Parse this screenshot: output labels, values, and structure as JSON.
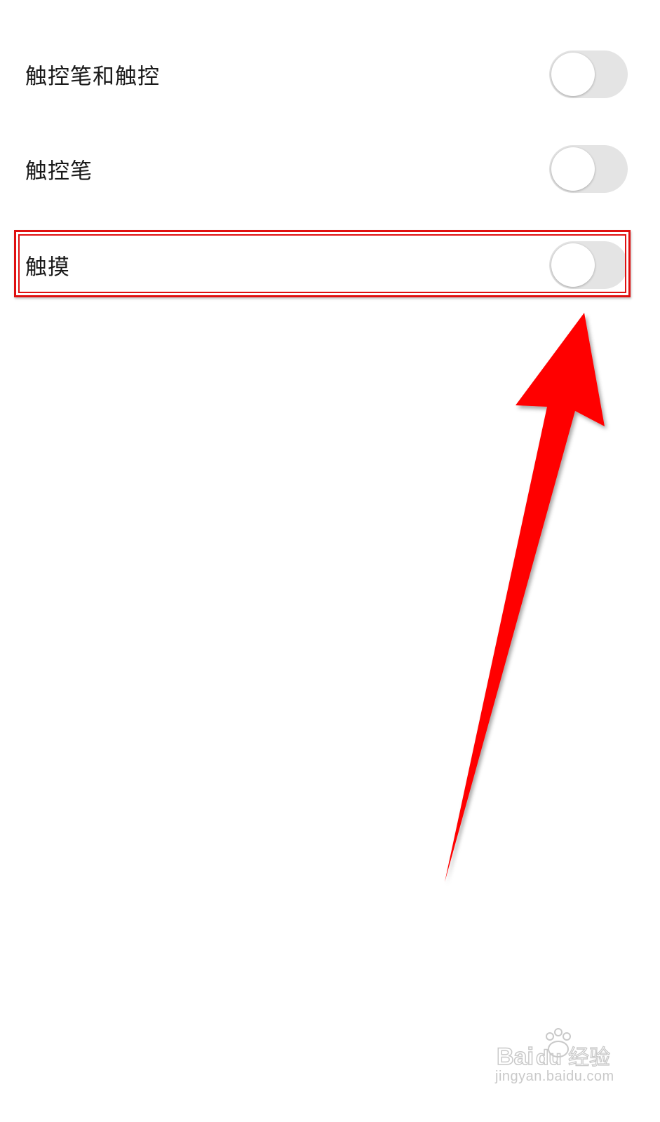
{
  "settings": {
    "items": [
      {
        "label": "触控笔和触控",
        "enabled": false
      },
      {
        "label": "触控笔",
        "enabled": false
      },
      {
        "label": "触摸",
        "enabled": false
      }
    ]
  },
  "annotation": {
    "highlight_color": "#e01010",
    "arrow_color": "#ff0000",
    "highlighted_item": "触摸"
  },
  "watermark": {
    "brand": "Baidu经验",
    "url": "jingyan.baidu.com"
  },
  "colors": {
    "toggle_off": "#e4e4e4",
    "text": "#1a1a1a",
    "background": "#ffffff"
  }
}
